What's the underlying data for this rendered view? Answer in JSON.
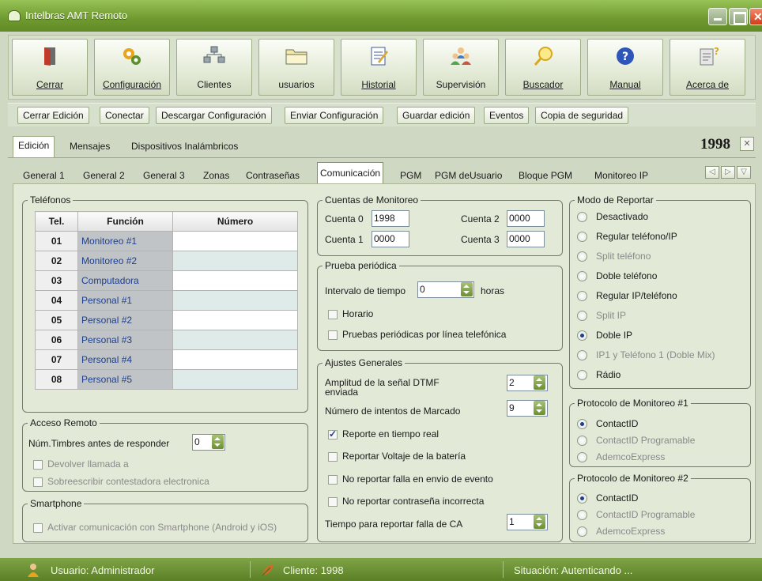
{
  "window": {
    "title": "Intelbras AMT Remoto"
  },
  "toolbar": {
    "buttons": [
      {
        "label": "Cerrar",
        "icon": "door-exit-icon"
      },
      {
        "label": "Configuración",
        "icon": "configuration-gear-icon"
      },
      {
        "label": "Clientes",
        "icon": "clients-network-icon"
      },
      {
        "label": "usuarios",
        "icon": "folder-icon"
      },
      {
        "label": "Historial",
        "icon": "notepad-history-icon"
      },
      {
        "label": "Supervisión",
        "icon": "users-supervision-icon"
      },
      {
        "label": "Buscador",
        "icon": "magnifier-icon"
      },
      {
        "label": "Manual",
        "icon": "help-question-icon"
      },
      {
        "label": "Acerca de",
        "icon": "about-document-icon"
      }
    ]
  },
  "actions": [
    "Cerrar Edición",
    "Conectar",
    "Descargar Configuración",
    "Enviar Configuración",
    "Guardar edición",
    "Eventos",
    "Copia de seguridad"
  ],
  "main_tabs": [
    "Edición",
    "Mensajes",
    "Dispositivos Inalámbricos"
  ],
  "account_number": "1998",
  "sub_tabs": [
    "General 1",
    "General 2",
    "General 3",
    "Zonas",
    "Contraseñas",
    "Comunicación",
    "PGM",
    "PGM deUsuario",
    "Bloque PGM",
    "Monitoreo IP"
  ],
  "telefonos": {
    "legend": "Teléfonos",
    "headers": [
      "Tel.",
      "Función",
      "Número"
    ],
    "rows": [
      {
        "tel": "01",
        "funcion": "Monitoreo #1",
        "numero": ""
      },
      {
        "tel": "02",
        "funcion": "Monitoreo #2",
        "numero": ""
      },
      {
        "tel": "03",
        "funcion": "Computadora",
        "numero": ""
      },
      {
        "tel": "04",
        "funcion": "Personal #1",
        "numero": ""
      },
      {
        "tel": "05",
        "funcion": "Personal #2",
        "numero": ""
      },
      {
        "tel": "06",
        "funcion": "Personal #3",
        "numero": ""
      },
      {
        "tel": "07",
        "funcion": "Personal #4",
        "numero": ""
      },
      {
        "tel": "08",
        "funcion": "Personal #5",
        "numero": ""
      }
    ]
  },
  "acceso_remoto": {
    "legend": "Acceso Remoto",
    "timbres_label": "Núm.Timbres antes de responder",
    "timbres_value": "0",
    "devolver": "Devolver llamada a",
    "sobreescribir": "Sobreescribir contestadora electronica"
  },
  "smartphone": {
    "legend": "Smartphone",
    "activar": "Activar comunicación con Smartphone (Android y iOS)"
  },
  "cuentas": {
    "legend": "Cuentas de Monitoreo",
    "c0_label": "Cuenta 0",
    "c0": "1998",
    "c1_label": "Cuenta 1",
    "c1": "0000",
    "c2_label": "Cuenta 2",
    "c2": "0000",
    "c3_label": "Cuenta 3",
    "c3": "0000"
  },
  "prueba": {
    "legend": "Prueba periódica",
    "intervalo_label": "Intervalo de tiempo",
    "intervalo_value": "0",
    "horas": "horas",
    "horario": "Horario",
    "pruebas_linea": "Pruebas periódicas por línea telefónica"
  },
  "ajustes": {
    "legend": "Ajustes Generales",
    "amplitud_label": "Amplitud de la señal DTMF enviada",
    "amplitud_value": "2",
    "intentos_label": "Número de intentos de Marcado",
    "intentos_value": "9",
    "reporte_tiempo_real": "Reporte en tiempo real",
    "reportar_voltaje": "Reportar Voltaje de la batería",
    "no_falla_envio": "No reportar falla en envio de evento",
    "no_contrasena": "No reportar contraseña incorrecta",
    "tiempo_ca_label": "Tiempo para reportar falla de CA",
    "tiempo_ca_value": "1"
  },
  "modo_reportar": {
    "legend": "Modo de Reportar",
    "options": [
      "Desactivado",
      "Regular teléfono/IP",
      "Split teléfono",
      "Doble teléfono",
      "Regular IP/teléfono",
      "Split IP",
      "Doble IP",
      "IP1 y Teléfono 1 (Doble Mix)",
      "Rádio"
    ],
    "selected": "Doble IP"
  },
  "protocolo1": {
    "legend": "Protocolo de Monitoreo #1",
    "options": [
      "ContactID",
      "ContactID Programable",
      "AdemcoExpress"
    ],
    "selected": "ContactID"
  },
  "protocolo2": {
    "legend": "Protocolo de Monitoreo #2",
    "options": [
      "ContactID",
      "ContactID Programable",
      "AdemcoExpress"
    ],
    "selected": "ContactID"
  },
  "status": {
    "usuario": "Usuario: Administrador",
    "cliente": "Cliente: 1998",
    "situacion": "Situación: Autenticando ..."
  },
  "colors": {
    "window_green": "#6f9a30",
    "panel": "#e2e9d7",
    "link_blue": "#1e3f8f"
  }
}
